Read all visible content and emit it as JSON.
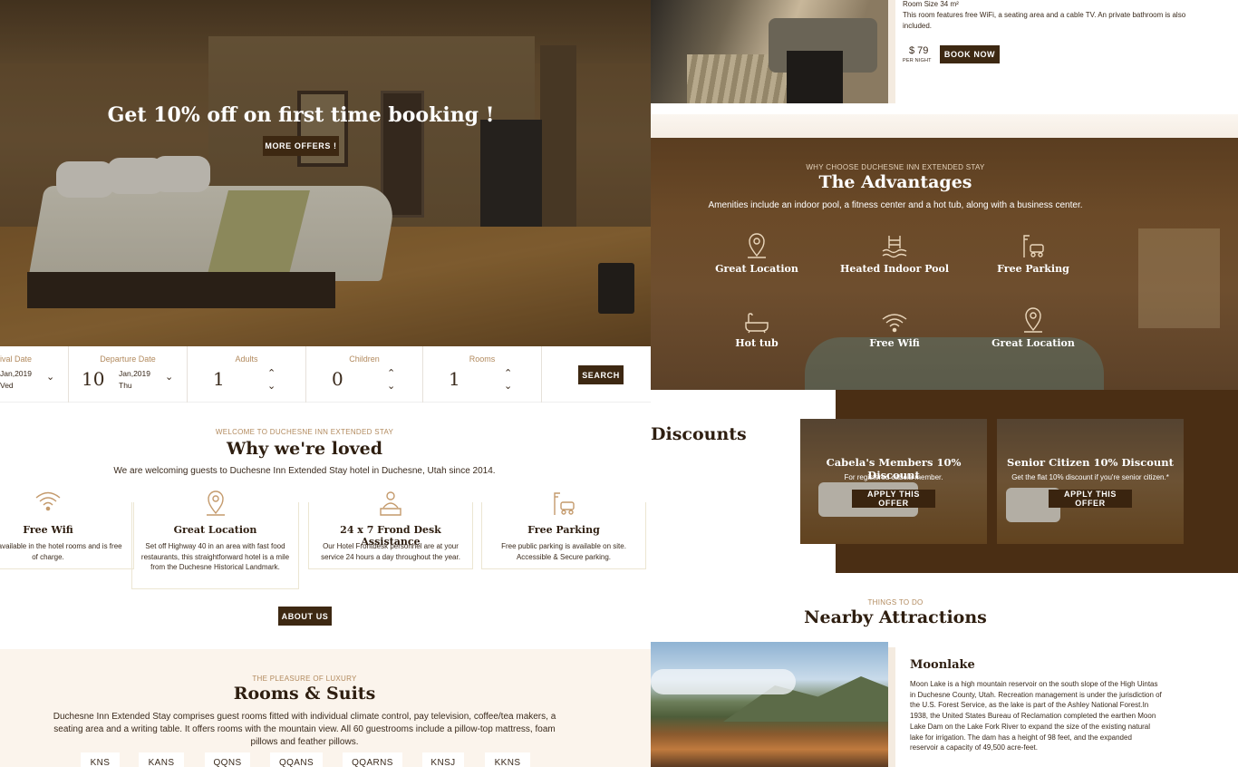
{
  "hero": {
    "headline": "Get 10% off on first time booking !",
    "cta": "MORE OFFERS !"
  },
  "booking": {
    "arrival": {
      "label": "ival Date",
      "month_year": "Jan,2019",
      "weekday": "Ved"
    },
    "departure": {
      "label": "Departure Date",
      "day": "10",
      "month_year": "Jan,2019",
      "weekday": "Thu"
    },
    "adults": {
      "label": "Adults",
      "value": "1"
    },
    "children": {
      "label": "Children",
      "value": "0"
    },
    "rooms": {
      "label": "Rooms",
      "value": "1"
    },
    "search": "SEARCH"
  },
  "loved": {
    "kicker": "WELCOME TO DUCHESNE INN EXTENDED STAY",
    "title": "Why we're loved",
    "subtitle": "We are welcoming guests to Duchesne Inn Extended Stay hotel in Duchesne, Utah since 2014.",
    "features": [
      {
        "icon": "wifi-icon",
        "title": "Free Wifi",
        "text": "WiFi is available in the hotel rooms and is free of charge."
      },
      {
        "icon": "location-pin-icon",
        "title": "Great Location",
        "text": "Set off Highway 40 in an area with fast food restaurants, this straightforward hotel is a mile from the Duchesne Historical Landmark."
      },
      {
        "icon": "concierge-icon",
        "title": "24 x 7 Frond Desk Assistance",
        "text": "Our Hotel Frontdesk personnel are at your service 24 hours a day throughout the year."
      },
      {
        "icon": "parking-icon",
        "title": "Free Parking",
        "text": "Free public parking is available on site. Accessible & Secure parking."
      }
    ],
    "button": "ABOUT US"
  },
  "rooms": {
    "kicker": "THE PLEASURE OF LUXURY",
    "title": "Rooms & Suits",
    "description": "Duchesne Inn Extended Stay comprises guest rooms fitted with individual climate control, pay television, coffee/tea makers, a seating area and a writing table. It offers rooms with the mountain view. All 60 guestrooms include a pillow-top mattress, foam pillows and feather pillows.",
    "tags": [
      "KNS",
      "KANS",
      "QQNS",
      "QQANS",
      "QQARNS",
      "KNSJ",
      "KKNS"
    ]
  },
  "room_card": {
    "size": "Room Size 34 m²",
    "info": "This room features free WiFi, a seating area and a cable TV. An private bathroom is also included.",
    "price": "$ 79",
    "per_night": "PER NIGHT",
    "book": "BOOK NOW"
  },
  "advantages": {
    "kicker": "WHY CHOOSE DUCHESNE INN EXTENDED STAY",
    "title": "The Advantages",
    "subtitle": "Amenities include an indoor pool, a fitness center and a hot tub, along with a business center.",
    "items": [
      {
        "icon": "location-pin-icon",
        "label": "Great Location"
      },
      {
        "icon": "pool-icon",
        "label": "Heated Indoor Pool"
      },
      {
        "icon": "parking-icon",
        "label": "Free Parking"
      },
      {
        "icon": "bathtub-icon",
        "label": "Hot tub"
      },
      {
        "icon": "wifi-icon",
        "label": "Free Wifi"
      },
      {
        "icon": "location-pin-icon",
        "label": "Great Location"
      }
    ]
  },
  "discounts": {
    "title_fragment": "Discounts",
    "cards": [
      {
        "title": "Cabela's Members 10% Discount",
        "text": "For registered cabela member.",
        "button": "APPLY THIS OFFER"
      },
      {
        "title": "Senior Citizen 10% Discount",
        "text": "Get the flat 10% discount if you're senior citizen.*",
        "button": "APPLY THIS OFFER"
      }
    ]
  },
  "nearby": {
    "kicker": "THINGS TO DO",
    "title": "Nearby Attractions",
    "place": "Moonlake",
    "text": "Moon Lake is a high mountain reservoir on the south slope of the High Uintas in Duchesne County, Utah. Recreation management is under the jurisdiction of the U.S. Forest Service, as the lake is part of the Ashley National Forest.In 1938, the United States Bureau of Reclamation completed the earthen Moon Lake Dam on the Lake Fork River to expand the size of the existing natural lake for irrigation. The dam has a height of 98 feet, and the expanded reservoir a capacity of 49,500 acre-feet."
  },
  "colors": {
    "brand_dark": "#3d2812",
    "accent_gold": "#b28a5e",
    "cream": "#fbf4ec"
  }
}
